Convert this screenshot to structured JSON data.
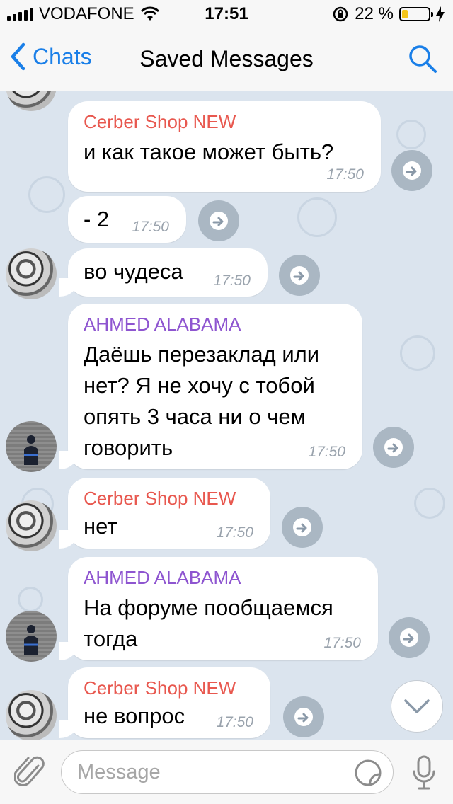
{
  "status_bar": {
    "carrier": "VODAFONE",
    "time": "17:51",
    "battery_percent": "22 %",
    "battery_level": 0.22,
    "battery_color": "#f5c518"
  },
  "nav": {
    "back_label": "Chats",
    "title": "Saved Messages",
    "search_icon": "search-icon",
    "accent_color": "#1a7fe8"
  },
  "colors": {
    "cerber": "#e8584f",
    "ahmed": "#8e55d0",
    "chat_bg": "#dbe4ee"
  },
  "messages": [
    {
      "sender": "Cerber Shop NEW",
      "text": "и как такое может быть?",
      "time": "17:50"
    },
    {
      "sender": "",
      "text": "- 2",
      "time": "17:50"
    },
    {
      "sender": "",
      "text": "во чудеса",
      "time": "17:50"
    },
    {
      "sender": "AHMED ALABAMA",
      "text": "Даёшь перезаклад или нет? Я не хочу с тобой опять 3 часа ни о чем говорить",
      "time": "17:50"
    },
    {
      "sender": "Cerber Shop NEW",
      "text": "нет",
      "time": "17:50"
    },
    {
      "sender": "AHMED ALABAMA",
      "text": "На форуме пообщаемся тогда",
      "time": "17:50"
    },
    {
      "sender": "Cerber Shop NEW",
      "text": "не вопрос",
      "time": "17:50"
    }
  ],
  "input": {
    "placeholder": "Message"
  }
}
